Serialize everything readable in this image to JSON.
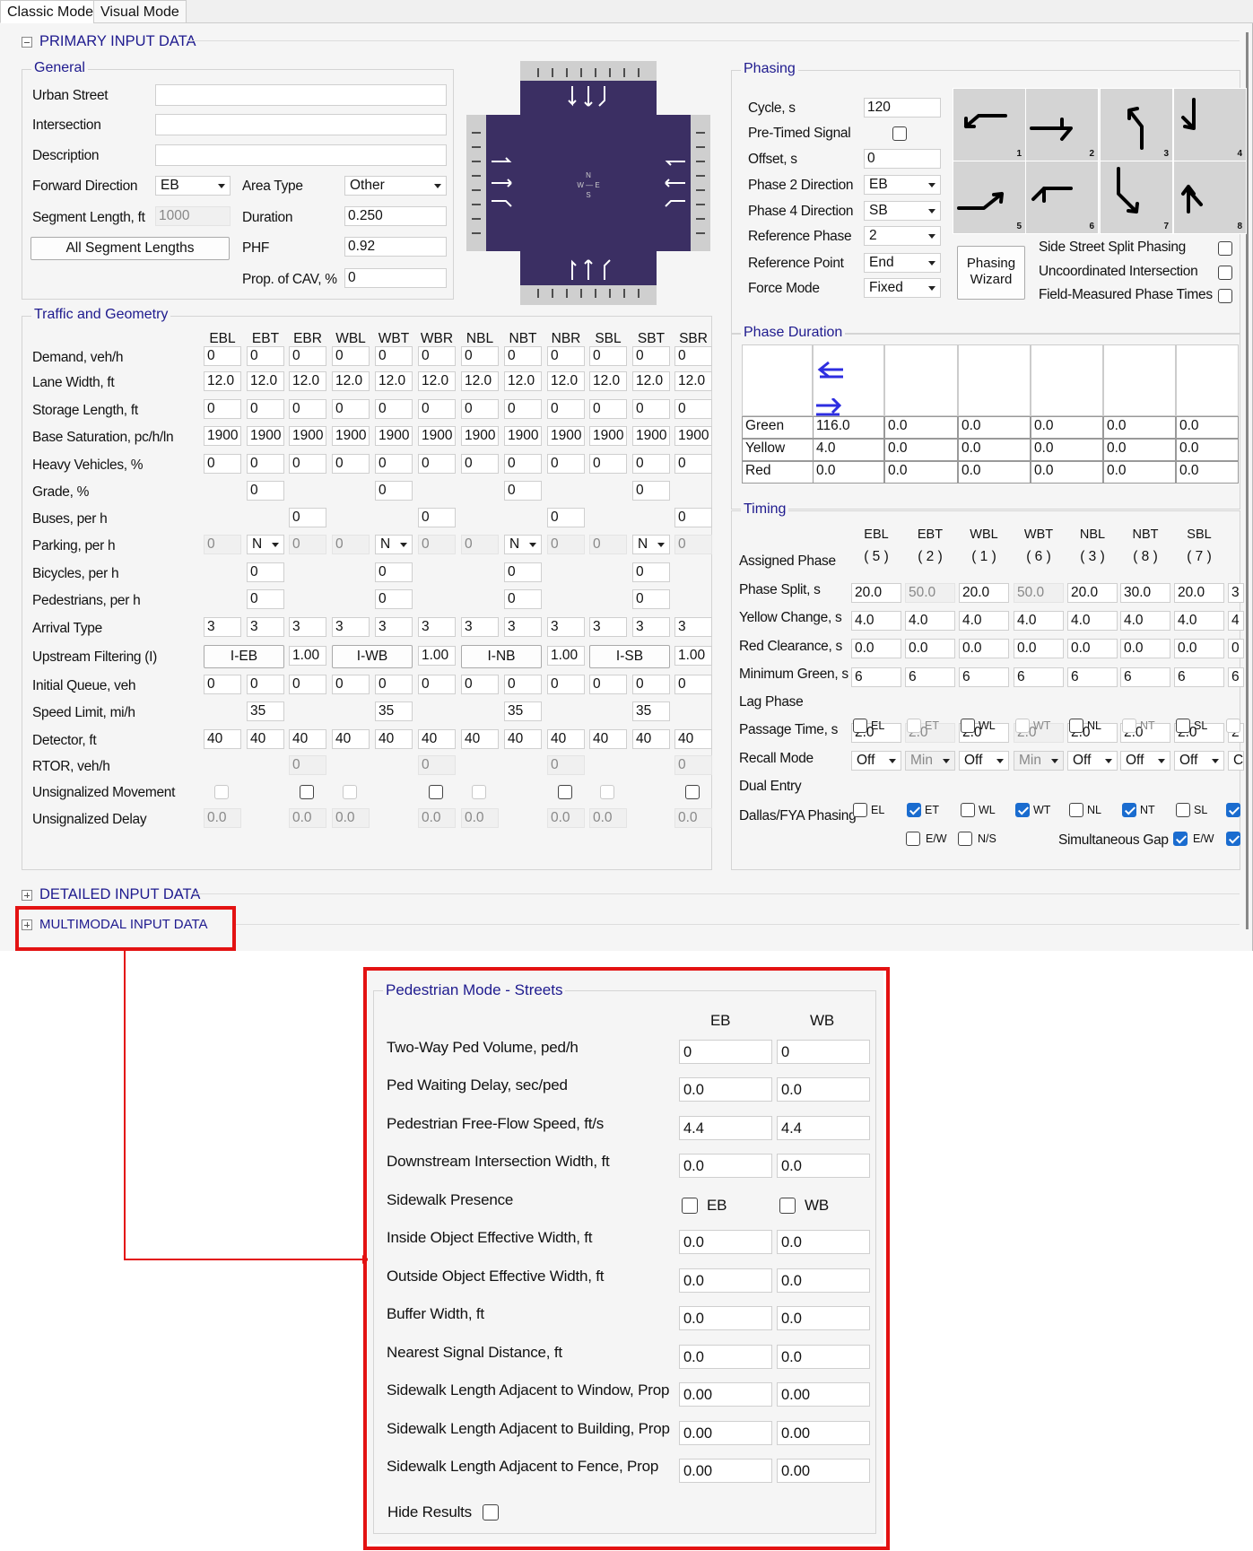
{
  "tabs": [
    "Classic Mode",
    "Visual Mode"
  ],
  "sections": {
    "primary": "PRIMARY INPUT DATA",
    "detailed": "DETAILED INPUT DATA",
    "multimodal": "MULTIMODAL INPUT DATA"
  },
  "general": {
    "title": "General",
    "urban_street_label": "Urban Street",
    "urban_street": "",
    "intersection_label": "Intersection",
    "intersection": "",
    "description_label": "Description",
    "description": "",
    "forward_direction_label": "Forward Direction",
    "forward_direction": "EB",
    "area_type_label": "Area Type",
    "area_type": "Other",
    "segment_length_label": "Segment Length, ft",
    "segment_length": "1000",
    "duration_label": "Duration",
    "duration": "0.250",
    "all_segment_lengths": "All Segment Lengths",
    "phf_label": "PHF",
    "phf": "0.92",
    "cav_label": "Prop. of CAV, %",
    "cav": "0"
  },
  "diagram": {
    "north": "N",
    "west_east": "W — E",
    "south": "S"
  },
  "traffic": {
    "title": "Traffic and Geometry",
    "columns": [
      "EBL",
      "EBT",
      "EBR",
      "WBL",
      "WBT",
      "WBR",
      "NBL",
      "NBT",
      "NBR",
      "SBL",
      "SBT",
      "SBR"
    ],
    "labels": {
      "demand": "Demand, veh/h",
      "lane_width": "Lane Width, ft",
      "storage": "Storage Length, ft",
      "base_sat": "Base Saturation, pc/h/ln",
      "heavy": "Heavy Vehicles, %",
      "grade": "Grade, %",
      "buses": "Buses, per h",
      "parking": "Parking, per h",
      "bicycles": "Bicycles, per h",
      "pedestrians": "Pedestrians, per h",
      "arrival": "Arrival Type",
      "upstream": "Upstream Filtering (I)",
      "initial_queue": "Initial Queue, veh",
      "speed": "Speed Limit, mi/h",
      "detector": "Detector, ft",
      "rtor": "RTOR, veh/h",
      "unsig_move": "Unsignalized Movement",
      "unsig_delay": "Unsignalized Delay"
    },
    "demand": [
      "0",
      "0",
      "0",
      "0",
      "0",
      "0",
      "0",
      "0",
      "0",
      "0",
      "0",
      "0"
    ],
    "lane_width": [
      "12.0",
      "12.0",
      "12.0",
      "12.0",
      "12.0",
      "12.0",
      "12.0",
      "12.0",
      "12.0",
      "12.0",
      "12.0",
      "12.0"
    ],
    "storage": [
      "0",
      "0",
      "0",
      "0",
      "0",
      "0",
      "0",
      "0",
      "0",
      "0",
      "0",
      "0"
    ],
    "base_sat": [
      "1900",
      "1900",
      "1900",
      "1900",
      "1900",
      "1900",
      "1900",
      "1900",
      "1900",
      "1900",
      "1900",
      "1900"
    ],
    "heavy": [
      "0",
      "0",
      "0",
      "0",
      "0",
      "0",
      "0",
      "0",
      "0",
      "0",
      "0",
      "0"
    ],
    "grade": [
      "0",
      "0",
      "0",
      "0"
    ],
    "buses": [
      "0",
      "0",
      "0",
      "0"
    ],
    "parking": [
      [
        "0",
        "N",
        "0"
      ],
      [
        "0",
        "N",
        "0"
      ],
      [
        "0",
        "N",
        "0"
      ],
      [
        "0",
        "N",
        "0"
      ]
    ],
    "bicycles": [
      "0",
      "0",
      "0",
      "0"
    ],
    "pedestrians": [
      "0",
      "0",
      "0",
      "0"
    ],
    "arrival": [
      "3",
      "3",
      "3",
      "3",
      "3",
      "3",
      "3",
      "3",
      "3",
      "3",
      "3",
      "3"
    ],
    "upstream": [
      [
        "I-EB",
        "1.00"
      ],
      [
        "I-WB",
        "1.00"
      ],
      [
        "I-NB",
        "1.00"
      ],
      [
        "I-SB",
        "1.00"
      ]
    ],
    "initial_queue": [
      "0",
      "0",
      "0",
      "0",
      "0",
      "0",
      "0",
      "0",
      "0",
      "0",
      "0",
      "0"
    ],
    "speed": [
      "35",
      "35",
      "35",
      "35"
    ],
    "detector": [
      "40",
      "40",
      "40",
      "40",
      "40",
      "40",
      "40",
      "40",
      "40",
      "40",
      "40",
      "40"
    ],
    "rtor": [
      "0",
      "0",
      "0",
      "0"
    ],
    "unsig_delay": [
      "0.0",
      "0.0",
      "0.0",
      "0.0",
      "0.0",
      "0.0",
      "0.0",
      "0.0"
    ]
  },
  "phasing": {
    "title": "Phasing",
    "cycle_label": "Cycle, s",
    "cycle": "120",
    "pretimed_label": "Pre-Timed Signal",
    "offset_label": "Offset, s",
    "offset": "0",
    "phase2_label": "Phase 2 Direction",
    "phase2": "EB",
    "phase4_label": "Phase 4 Direction",
    "phase4": "SB",
    "ref_phase_label": "Reference Phase",
    "ref_phase": "2",
    "ref_point_label": "Reference Point",
    "ref_point": "End",
    "force_mode_label": "Force Mode",
    "force_mode": "Fixed",
    "wizard": "Phasing Wizard",
    "side_split": "Side Street Split Phasing",
    "uncoordinated": "Uncoordinated Intersection",
    "field_measured": "Field-Measured Phase Times",
    "phase_numbers": [
      "1",
      "2",
      "3",
      "4",
      "5",
      "6",
      "7",
      "8"
    ]
  },
  "phase_duration": {
    "title": "Phase Duration",
    "rows": [
      {
        "label": "Green",
        "values": [
          "116.0",
          "0.0",
          "0.0",
          "0.0",
          "0.0",
          "0.0"
        ]
      },
      {
        "label": "Yellow",
        "values": [
          "4.0",
          "0.0",
          "0.0",
          "0.0",
          "0.0",
          "0.0"
        ]
      },
      {
        "label": "Red",
        "values": [
          "0.0",
          "0.0",
          "0.0",
          "0.0",
          "0.0",
          "0.0"
        ]
      }
    ]
  },
  "timing": {
    "title": "Timing",
    "columns": [
      "EBL",
      "EBT",
      "WBL",
      "WBT",
      "NBL",
      "NBT",
      "SBL"
    ],
    "phases": [
      "( 5 )",
      "( 2 )",
      "( 1 )",
      "( 6 )",
      "( 3 )",
      "( 8 )",
      "( 7 )"
    ],
    "labels": {
      "assigned": "Assigned Phase",
      "split": "Phase Split, s",
      "yellow": "Yellow Change, s",
      "red": "Red Clearance, s",
      "min_green": "Minimum Green, s",
      "lag": "Lag Phase",
      "passage": "Passage Time, s",
      "recall": "Recall Mode",
      "dual": "Dual Entry",
      "dallas": "Dallas/FYA Phasing",
      "sim_gap": "Simultaneous Gap"
    },
    "split": [
      "20.0",
      "50.0",
      "20.0",
      "50.0",
      "20.0",
      "30.0",
      "20.0",
      "3"
    ],
    "yellow": [
      "4.0",
      "4.0",
      "4.0",
      "4.0",
      "4.0",
      "4.0",
      "4.0",
      "4"
    ],
    "red": [
      "0.0",
      "0.0",
      "0.0",
      "0.0",
      "0.0",
      "0.0",
      "0.0",
      "0"
    ],
    "min_green": [
      "6",
      "6",
      "6",
      "6",
      "6",
      "6",
      "6",
      "6"
    ],
    "lag": [
      "EL",
      "ET",
      "WL",
      "WT",
      "NL",
      "NT",
      "SL"
    ],
    "passage": [
      "2.0",
      "2.0",
      "2.0",
      "2.0",
      "2.0",
      "2.0",
      "2.0",
      "2"
    ],
    "recall": [
      "Off",
      "Min",
      "Off",
      "Min",
      "Off",
      "Off",
      "Off",
      "C"
    ],
    "dual": [
      "EL",
      "ET",
      "WL",
      "WT",
      "NL",
      "NT",
      "SL"
    ],
    "dallas": [
      "E/W",
      "N/S"
    ],
    "sim_gap_dir": "E/W"
  },
  "pedestrian": {
    "title": "Pedestrian Mode - Streets",
    "eb": "EB",
    "wb": "WB",
    "rows": [
      {
        "label": "Two-Way Ped Volume, ped/h",
        "eb": "0",
        "wb": "0"
      },
      {
        "label": "Ped Waiting Delay, sec/ped",
        "eb": "0.0",
        "wb": "0.0"
      },
      {
        "label": "Pedestrian Free-Flow Speed, ft/s",
        "eb": "4.4",
        "wb": "4.4"
      },
      {
        "label": "Downstream Intersection Width, ft",
        "eb": "0.0",
        "wb": "0.0"
      },
      {
        "label": "Sidewalk Presence",
        "eb": "EB",
        "wb": "WB"
      },
      {
        "label": "Inside Object Effective Width, ft",
        "eb": "0.0",
        "wb": "0.0"
      },
      {
        "label": "Outside Object Effective Width, ft",
        "eb": "0.0",
        "wb": "0.0"
      },
      {
        "label": "Buffer Width, ft",
        "eb": "0.0",
        "wb": "0.0"
      },
      {
        "label": "Nearest Signal Distance, ft",
        "eb": "0.0",
        "wb": "0.0"
      },
      {
        "label": "Sidewalk Length Adjacent to Window, Prop",
        "eb": "0.00",
        "wb": "0.00"
      },
      {
        "label": "Sidewalk Length Adjacent to Building, Prop",
        "eb": "0.00",
        "wb": "0.00"
      },
      {
        "label": "Sidewalk Length Adjacent to Fence, Prop",
        "eb": "0.00",
        "wb": "0.00"
      }
    ],
    "hide_results": "Hide Results"
  },
  "colors": {
    "accent": "#1e1a8e",
    "highlight": "#e31212",
    "check": "#1a6ccf",
    "intersection": "#3b2f63"
  }
}
